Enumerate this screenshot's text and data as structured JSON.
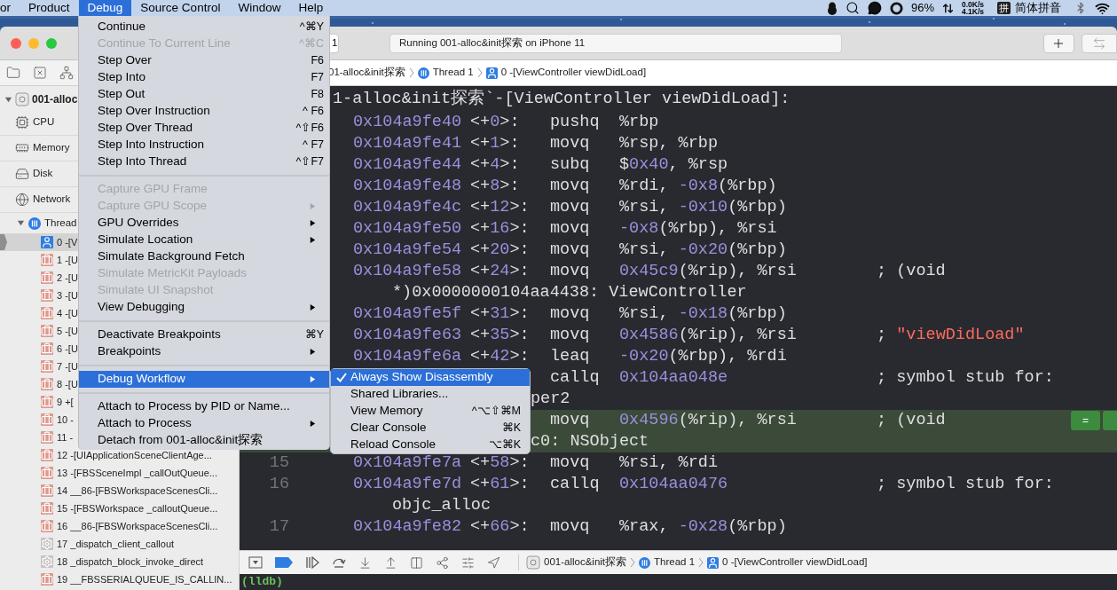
{
  "menu_bar": {
    "items": [
      {
        "label": "or",
        "selected": false
      },
      {
        "label": "Product",
        "selected": false
      },
      {
        "label": "Debug",
        "selected": true
      },
      {
        "label": "Source Control",
        "selected": false
      },
      {
        "label": "Window",
        "selected": false
      },
      {
        "label": "Help",
        "selected": false
      }
    ],
    "battery": "96%",
    "upload": "0.0K/s",
    "download": "4.1K/s",
    "input_badge": "拼",
    "input_method": "简体拼音"
  },
  "window": {
    "scheme": "1",
    "status": "Running 001-alloc&init探索 on iPhone 11"
  },
  "jump_bar": {
    "project": "01-alloc&init探索",
    "thread": "Thread 1",
    "frame": "0 -[ViewController viewDidLoad]"
  },
  "navigator": {
    "process": "001-alloc",
    "gauges": [
      {
        "label": "CPU",
        "kind": "cpu"
      },
      {
        "label": "Memory",
        "kind": "memory"
      },
      {
        "label": "Disk",
        "kind": "disk"
      },
      {
        "label": "Network",
        "kind": "network"
      }
    ],
    "thread": {
      "label": "Thread",
      "expanded": true
    },
    "frames": [
      {
        "label": "0 -[V",
        "kind": "user",
        "selected": true
      },
      {
        "label": "1 -[U",
        "kind": "framework",
        "selected": false
      },
      {
        "label": "2 -[U",
        "kind": "framework",
        "selected": false
      },
      {
        "label": "3 -[U",
        "kind": "framework",
        "selected": false
      },
      {
        "label": "4 -[U",
        "kind": "framework",
        "selected": false
      },
      {
        "label": "5 -[U",
        "kind": "framework",
        "selected": false
      },
      {
        "label": "6 -[U",
        "kind": "framework",
        "selected": false
      },
      {
        "label": "7 -[U",
        "kind": "framework",
        "selected": false
      },
      {
        "label": "8 -[U",
        "kind": "framework",
        "selected": false
      },
      {
        "label": "9 +[",
        "kind": "framework",
        "selected": false
      },
      {
        "label": "10 -",
        "kind": "framework",
        "selected": false
      },
      {
        "label": "11 -",
        "kind": "framework",
        "selected": false
      },
      {
        "label": "12 -[UIApplicationSceneClientAge...",
        "kind": "framework",
        "selected": false
      },
      {
        "label": "13 -[FBSSceneImpl _callOutQueue...",
        "kind": "framework",
        "selected": false
      },
      {
        "label": "14 __86-[FBSWorkspaceScenesCli...",
        "kind": "framework",
        "selected": false
      },
      {
        "label": "15 -[FBSWorkspace _calloutQueue...",
        "kind": "framework",
        "selected": false
      },
      {
        "label": "16 __86-[FBSWorkspaceScenesCli...",
        "kind": "framework",
        "selected": false
      },
      {
        "label": "17 _dispatch_client_callout",
        "kind": "system",
        "selected": false
      },
      {
        "label": "18 _dispatch_block_invoke_direct",
        "kind": "system",
        "selected": false
      },
      {
        "label": "19 __FBSSERIALQUEUE_IS_CALLIN...",
        "kind": "framework",
        "selected": false
      }
    ]
  },
  "disassembly": {
    "header": "1-alloc&init探索`-[ViewController viewDidLoad]:",
    "lines": [
      {
        "kind": "instruction",
        "address": "0x104a9fe40",
        "offset": "<+0>:",
        "op": "pushq",
        "args": "%rbp",
        "current": false
      },
      {
        "kind": "instruction",
        "address": "0x104a9fe41",
        "offset": "<+1>:",
        "op": "movq",
        "args": "%rsp, %rbp",
        "current": false
      },
      {
        "kind": "instruction",
        "address": "0x104a9fe44",
        "offset": "<+4>:",
        "op": "subq",
        "args": "$0x40, %rsp",
        "current": false
      },
      {
        "kind": "instruction",
        "address": "0x104a9fe48",
        "offset": "<+8>:",
        "op": "movq",
        "args": "%rdi, -0x8(%rbp)",
        "current": false
      },
      {
        "kind": "instruction",
        "address": "0x104a9fe4c",
        "offset": "<+12>:",
        "op": "movq",
        "args": "%rsi, -0x10(%rbp)",
        "current": false
      },
      {
        "kind": "instruction",
        "address": "0x104a9fe50",
        "offset": "<+16>:",
        "op": "movq",
        "args": "-0x8(%rbp), %rsi",
        "current": false
      },
      {
        "kind": "instruction",
        "address": "0x104a9fe54",
        "offset": "<+20>:",
        "op": "movq",
        "args": "%rsi, -0x20(%rbp)",
        "current": false
      },
      {
        "kind": "instruction",
        "address": "0x104a9fe58",
        "offset": "<+24>:",
        "op": "movq",
        "args": "0x45c9(%rip), %rsi",
        "comment": "; (void",
        "current": false
      },
      {
        "kind": "continuation",
        "text": "*)0x0000000104aa4438: ViewController",
        "current": false
      },
      {
        "kind": "instruction",
        "address": "0x104a9fe5f",
        "offset": "<+31>:",
        "op": "movq",
        "args": "%rsi, -0x18(%rbp)",
        "current": false
      },
      {
        "kind": "instruction",
        "address": "0x104a9fe63",
        "offset": "<+35>:",
        "op": "movq",
        "args": "0x4586(%rip), %rsi",
        "comment": "; \"viewDidLoad\"",
        "current": false
      },
      {
        "kind": "instruction",
        "address": "0x104a9fe6a",
        "offset": "<+42>:",
        "op": "leaq",
        "args": "-0x20(%rbp), %rdi",
        "current": false
      },
      {
        "kind": "instruction",
        "op": "callq",
        "args": "0x104aa048e",
        "comment": "; symbol stub for:",
        "current": false
      },
      {
        "kind": "fragment",
        "text": "per2",
        "current": false
      },
      {
        "kind": "instruction",
        "op": "movq",
        "args": "0x4596(%rip), %rsi",
        "comment": "; (void",
        "marker": "=",
        "current": true
      },
      {
        "kind": "fragment",
        "text": "c0: NSObject",
        "current": true
      },
      {
        "kind": "instruction",
        "number": "15",
        "address": "0x104a9fe7a",
        "offset": "<+58>:",
        "op": "movq",
        "args": "%rsi, %rdi",
        "current": false
      },
      {
        "kind": "instruction",
        "number": "16",
        "address": "0x104a9fe7d",
        "offset": "<+61>:",
        "op": "callq",
        "args": "0x104aa0476",
        "comment": "; symbol stub for:",
        "current": false
      },
      {
        "kind": "continuation",
        "text": "objc_alloc",
        "current": false
      },
      {
        "kind": "instruction",
        "number": "17",
        "address": "0x104a9fe82",
        "offset": "<+66>:",
        "op": "movq",
        "args": "%rax, -0x28(%rbp)",
        "current": false
      }
    ]
  },
  "debug_bar": {
    "breakpoints_active": true,
    "project": "001-alloc&init探索",
    "thread": "Thread 1",
    "frame": "0 -[ViewController viewDidLoad]"
  },
  "console": {
    "prompt": "(lldb)"
  },
  "debug_menu": {
    "items": [
      {
        "kind": "item",
        "label": "Continue",
        "shortcut": "^⌘Y",
        "disabled": false,
        "submenu": false,
        "selected": false
      },
      {
        "kind": "item",
        "label": "Continue To Current Line",
        "shortcut": "^⌘C",
        "disabled": true,
        "submenu": false,
        "selected": false
      },
      {
        "kind": "item",
        "label": "Step Over",
        "shortcut": "F6",
        "disabled": false,
        "submenu": false,
        "selected": false
      },
      {
        "kind": "item",
        "label": "Step Into",
        "shortcut": "F7",
        "disabled": false,
        "submenu": false,
        "selected": false
      },
      {
        "kind": "item",
        "label": "Step Out",
        "shortcut": "F8",
        "disabled": false,
        "submenu": false,
        "selected": false
      },
      {
        "kind": "item",
        "label": "Step Over Instruction",
        "shortcut": "^ F6",
        "disabled": false,
        "submenu": false,
        "selected": false
      },
      {
        "kind": "item",
        "label": "Step Over Thread",
        "shortcut": "^⇧F6",
        "disabled": false,
        "submenu": false,
        "selected": false
      },
      {
        "kind": "item",
        "label": "Step Into Instruction",
        "shortcut": "^ F7",
        "disabled": false,
        "submenu": false,
        "selected": false
      },
      {
        "kind": "item",
        "label": "Step Into Thread",
        "shortcut": "^⇧F7",
        "disabled": false,
        "submenu": false,
        "selected": false
      },
      {
        "kind": "separator"
      },
      {
        "kind": "item",
        "label": "Capture GPU Frame",
        "disabled": true,
        "submenu": false,
        "selected": false
      },
      {
        "kind": "item",
        "label": "Capture GPU Scope",
        "disabled": true,
        "submenu": true,
        "selected": false
      },
      {
        "kind": "item",
        "label": "GPU Overrides",
        "disabled": false,
        "submenu": true,
        "selected": false
      },
      {
        "kind": "item",
        "label": "Simulate Location",
        "disabled": false,
        "submenu": true,
        "selected": false
      },
      {
        "kind": "item",
        "label": "Simulate Background Fetch",
        "disabled": false,
        "submenu": false,
        "selected": false
      },
      {
        "kind": "item",
        "label": "Simulate MetricKit Payloads",
        "disabled": true,
        "submenu": false,
        "selected": false
      },
      {
        "kind": "item",
        "label": "Simulate UI Snapshot",
        "disabled": true,
        "submenu": false,
        "selected": false
      },
      {
        "kind": "item",
        "label": "View Debugging",
        "disabled": false,
        "submenu": true,
        "selected": false
      },
      {
        "kind": "separator"
      },
      {
        "kind": "item",
        "label": "Deactivate Breakpoints",
        "shortcut": "⌘Y",
        "disabled": false,
        "submenu": false,
        "selected": false
      },
      {
        "kind": "item",
        "label": "Breakpoints",
        "disabled": false,
        "submenu": true,
        "selected": false
      },
      {
        "kind": "separator"
      },
      {
        "kind": "item",
        "label": "Debug Workflow",
        "disabled": false,
        "submenu": true,
        "selected": true
      },
      {
        "kind": "separator"
      },
      {
        "kind": "item",
        "label": "Attach to Process by PID or Name...",
        "disabled": false,
        "submenu": false,
        "selected": false
      },
      {
        "kind": "item",
        "label": "Attach to Process",
        "disabled": false,
        "submenu": true,
        "selected": false
      },
      {
        "kind": "item",
        "label": "Detach from 001-alloc&init探索",
        "disabled": false,
        "submenu": false,
        "selected": false
      }
    ]
  },
  "debug_workflow_submenu": {
    "items": [
      {
        "label": "Always Show Disassembly",
        "checked": true,
        "selected": true
      },
      {
        "label": "Shared Libraries...",
        "checked": false,
        "selected": false
      },
      {
        "label": "View Memory",
        "shortcut": "^⌥⇧⌘M",
        "checked": false,
        "selected": false
      },
      {
        "label": "Clear Console",
        "shortcut": "⌘K",
        "checked": false,
        "selected": false
      },
      {
        "label": "Reload Console",
        "shortcut": "⌥⌘K",
        "checked": false,
        "selected": false
      }
    ]
  }
}
